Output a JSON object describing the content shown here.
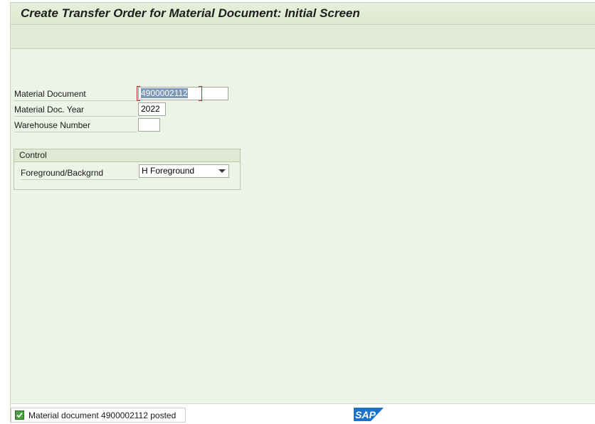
{
  "window": {
    "title": "Create Transfer Order for Material Document: Initial Screen"
  },
  "form": {
    "material_document": {
      "label": "Material Document",
      "value": "4900002112"
    },
    "material_doc_year": {
      "label": "Material Doc. Year",
      "value": "2022"
    },
    "warehouse_number": {
      "label": "Warehouse Number",
      "value": ""
    }
  },
  "control": {
    "title": "Control",
    "foreground_backgrnd": {
      "label": "Foreground/Backgrnd",
      "value": "H Foreground"
    }
  },
  "status": {
    "message": "Material document 4900002112 posted",
    "icon": "success-check-icon"
  },
  "brand": {
    "logo_text": "SAP",
    "logo_color": "#1a73c8"
  }
}
